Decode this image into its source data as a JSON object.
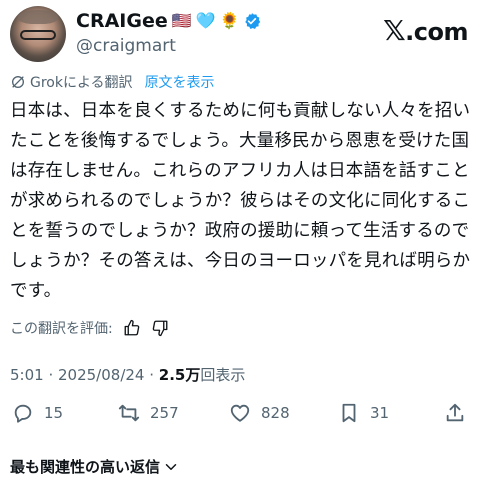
{
  "author": {
    "name": "CRAIGee",
    "emojis": [
      "🇺🇸",
      "🩵",
      "🌻"
    ],
    "handle": "@craigmart"
  },
  "logo": {
    "x": "𝕏",
    "text": ".com"
  },
  "translation": {
    "label": "Grokによる翻訳",
    "show_original": "原文を表示"
  },
  "tweet": {
    "text": "日本は、日本を良くするために何も貢献しない人々を招いたことを後悔するでしょう。大量移民から恩恵を受けた国は存在しません。これらのアフリカ人は日本語を話すことが求められるのでしょうか？彼らはその文化に同化することを誓うのでしょうか？政府の援助に頼って生活するのでしょうか？その答えは、今日のヨーロッパを見れば明らかです。"
  },
  "rate": {
    "label": "この翻訳を評価:"
  },
  "meta": {
    "time": "5:01",
    "sep": " · ",
    "date": "2025/08/24",
    "views_count": "2.5万",
    "views_label": "回表示"
  },
  "actions": {
    "replies": "15",
    "reposts": "257",
    "likes": "828",
    "bookmarks": "31"
  },
  "replies_sort": {
    "label": "最も関連性の高い返信"
  },
  "colors": {
    "accent": "#1d9bf0",
    "secondary": "#536471",
    "text": "#0f1419"
  },
  "icons": [
    "verified-badge-icon",
    "grok-icon",
    "thumbs-up-icon",
    "thumbs-down-icon",
    "reply-icon",
    "repost-icon",
    "like-icon",
    "bookmark-icon",
    "share-icon",
    "chevron-down-icon"
  ]
}
